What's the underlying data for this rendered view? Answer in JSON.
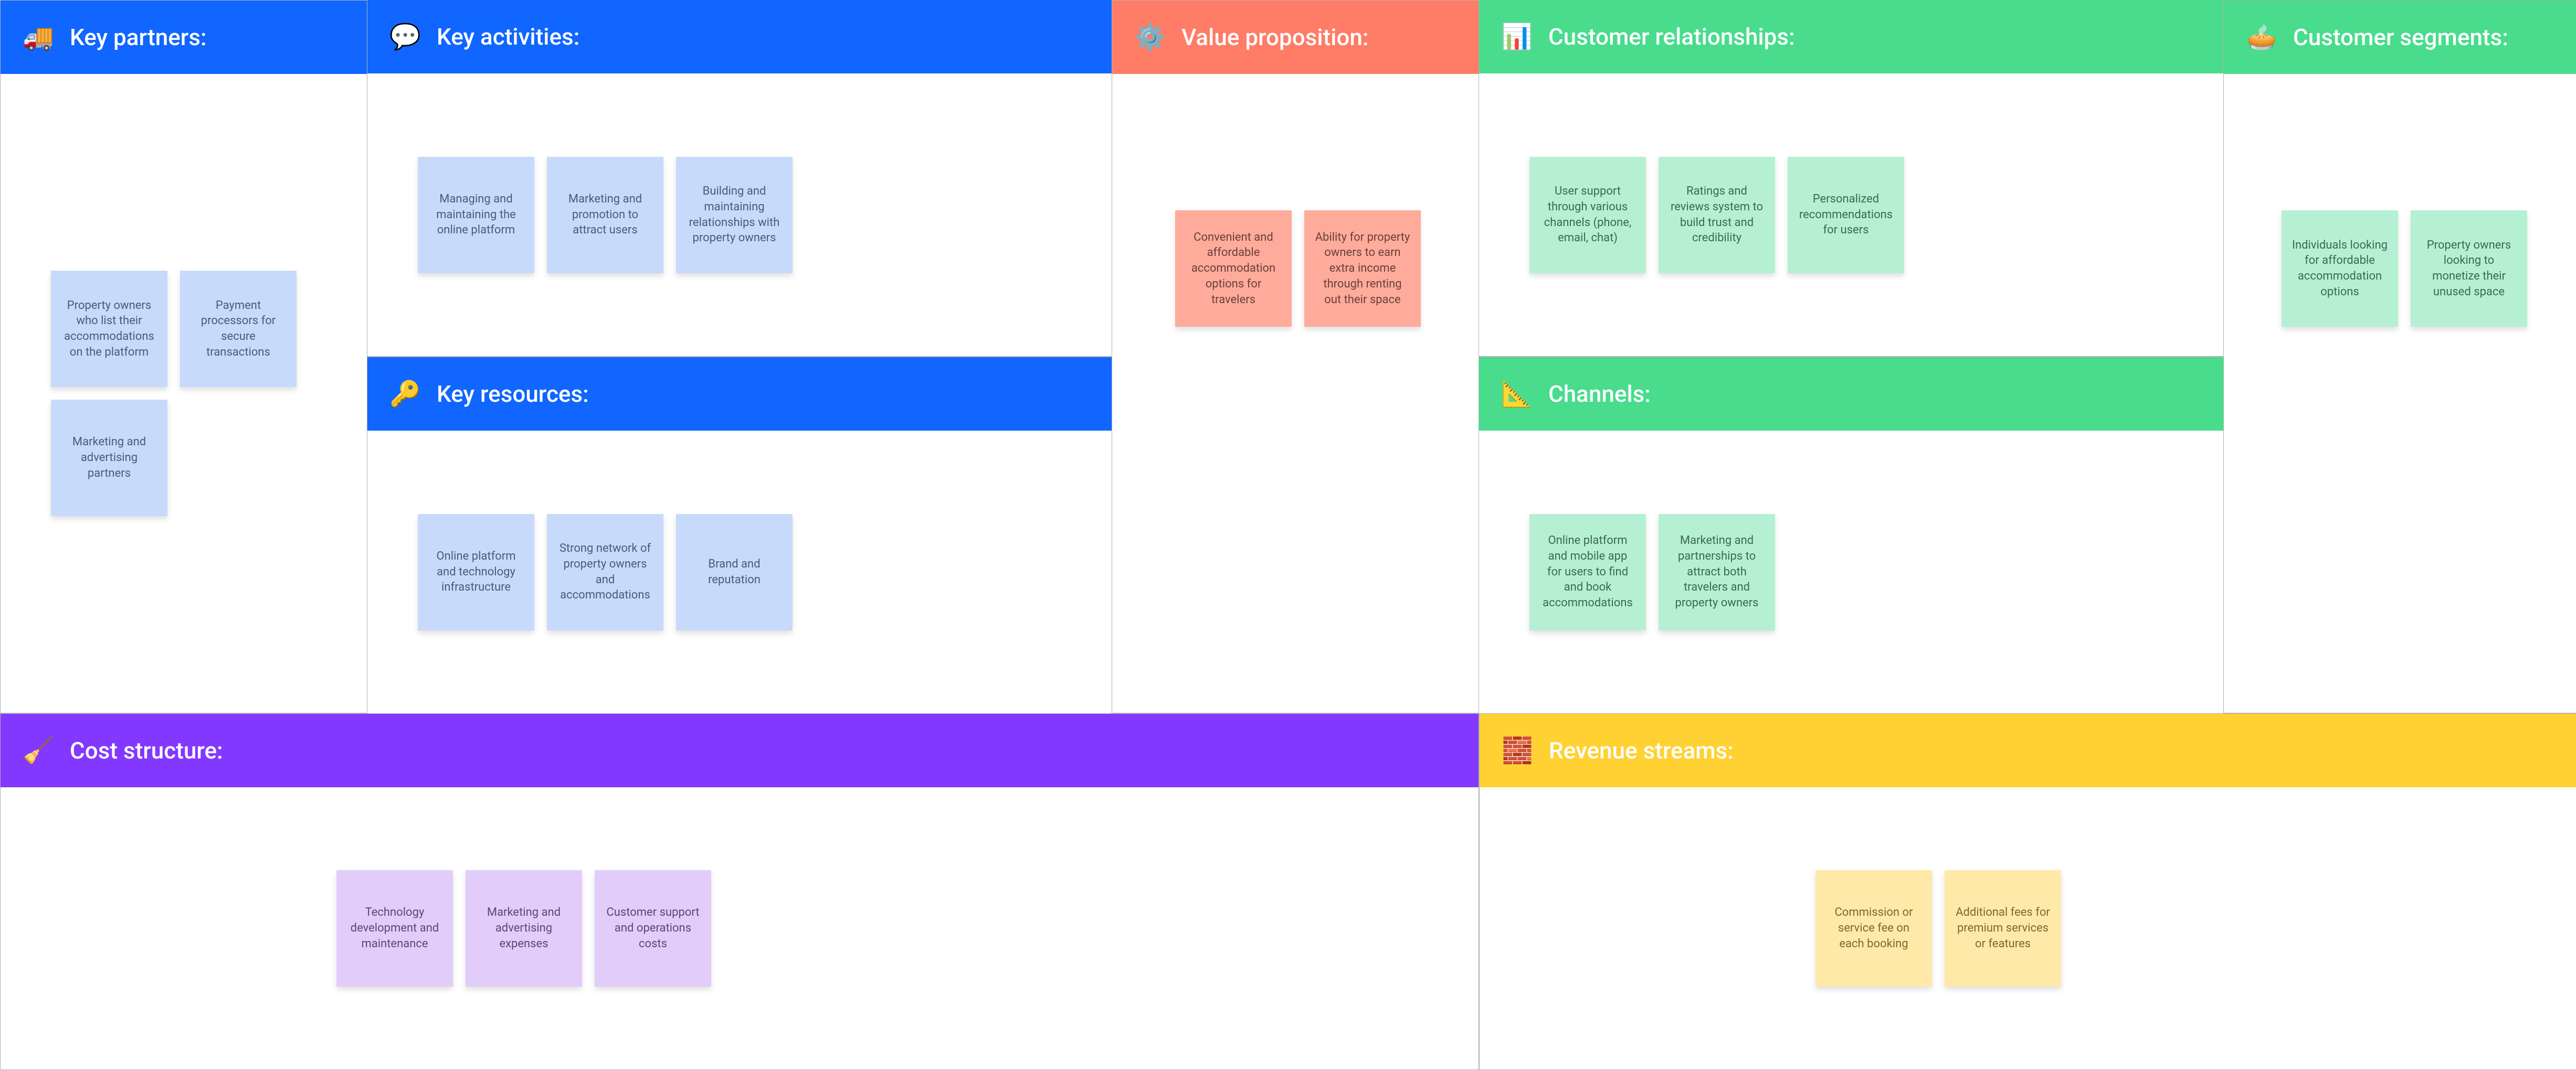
{
  "sections": {
    "key_partners": {
      "title": "Key partners:",
      "icon": "🚚",
      "notes": [
        "Property owners who list their accommodations on the platform",
        "Payment processors for secure transactions",
        "Marketing and advertising partners"
      ]
    },
    "key_activities": {
      "title": "Key activities:",
      "icon": "💬",
      "notes": [
        "Managing and maintaining the online platform",
        "Marketing and promotion to attract users",
        "Building and maintaining relationships with property owners"
      ]
    },
    "key_resources": {
      "title": "Key resources:",
      "icon": "🔑",
      "notes": [
        "Online platform and technology infrastructure",
        "Strong network of property owners and accommodations",
        "Brand and reputation"
      ]
    },
    "value_proposition": {
      "title": "Value proposition:",
      "icon": "⚙️",
      "notes": [
        "Convenient and affordable accommodation options for travelers",
        "Ability for property owners to earn extra income through renting out their space"
      ]
    },
    "customer_relationships": {
      "title": "Customer relationships:",
      "icon": "📊",
      "notes": [
        "User support through various channels (phone, email, chat)",
        "Ratings and reviews system to build trust and credibility",
        "Personalized recommendations for users"
      ]
    },
    "channels": {
      "title": "Channels:",
      "icon": "📐",
      "notes": [
        "Online platform and mobile app for users to find and book accommodations",
        "Marketing and partnerships to attract both travelers and property owners"
      ]
    },
    "customer_segments": {
      "title": "Customer segments:",
      "icon": "🥧",
      "notes": [
        "Individuals looking for affordable accommodation options",
        "Property owners looking to monetize their unused space"
      ]
    },
    "cost_structure": {
      "title": "Cost structure:",
      "icon": "🧹",
      "notes": [
        "Technology development and maintenance",
        "Marketing and advertising expenses",
        "Customer support and operations costs"
      ]
    },
    "revenue_streams": {
      "title": "Revenue streams:",
      "icon": "🧱",
      "notes": [
        "Commission or service fee on each booking",
        "Additional fees for premium services or features"
      ]
    }
  }
}
